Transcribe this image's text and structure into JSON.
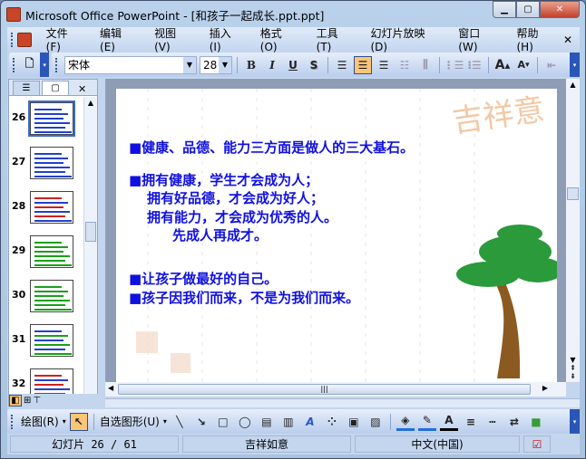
{
  "window": {
    "title": "Microsoft Office PowerPoint - [和孩子一起成长.ppt.ppt]"
  },
  "menu": [
    "文件(F)",
    "编辑(E)",
    "视图(V)",
    "插入(I)",
    "格式(O)",
    "工具(T)",
    "幻灯片放映(D)",
    "窗口(W)",
    "帮助(H)"
  ],
  "format": {
    "font": "宋体",
    "size": "28",
    "bold": "B",
    "italic": "I",
    "underline": "U",
    "shadow": "S"
  },
  "panel": {
    "slides": [
      "26",
      "27",
      "28",
      "29",
      "30",
      "31",
      "32"
    ],
    "selected": "26"
  },
  "slide": {
    "lines": [
      "■健康、品德、能力三方面是做人的三大基石。",
      "■拥有健康，学生才会成为人；",
      "拥有好品德，才会成为好人；",
      "拥有能力，才会成为优秀的人。",
      "先成人再成才。",
      "■让孩子做最好的自己。",
      "■孩子因我们而来，不是为我们而来。"
    ],
    "logo": "吉祥意"
  },
  "drawing": {
    "draw": "绘图(R)",
    "autoshapes": "自选图形(U)"
  },
  "status": {
    "slide": "幻灯片 26 / 61",
    "design": "吉祥如意",
    "language": "中文(中国)"
  },
  "colors": {
    "text": "#1010e0",
    "accent": "#fbc577"
  }
}
